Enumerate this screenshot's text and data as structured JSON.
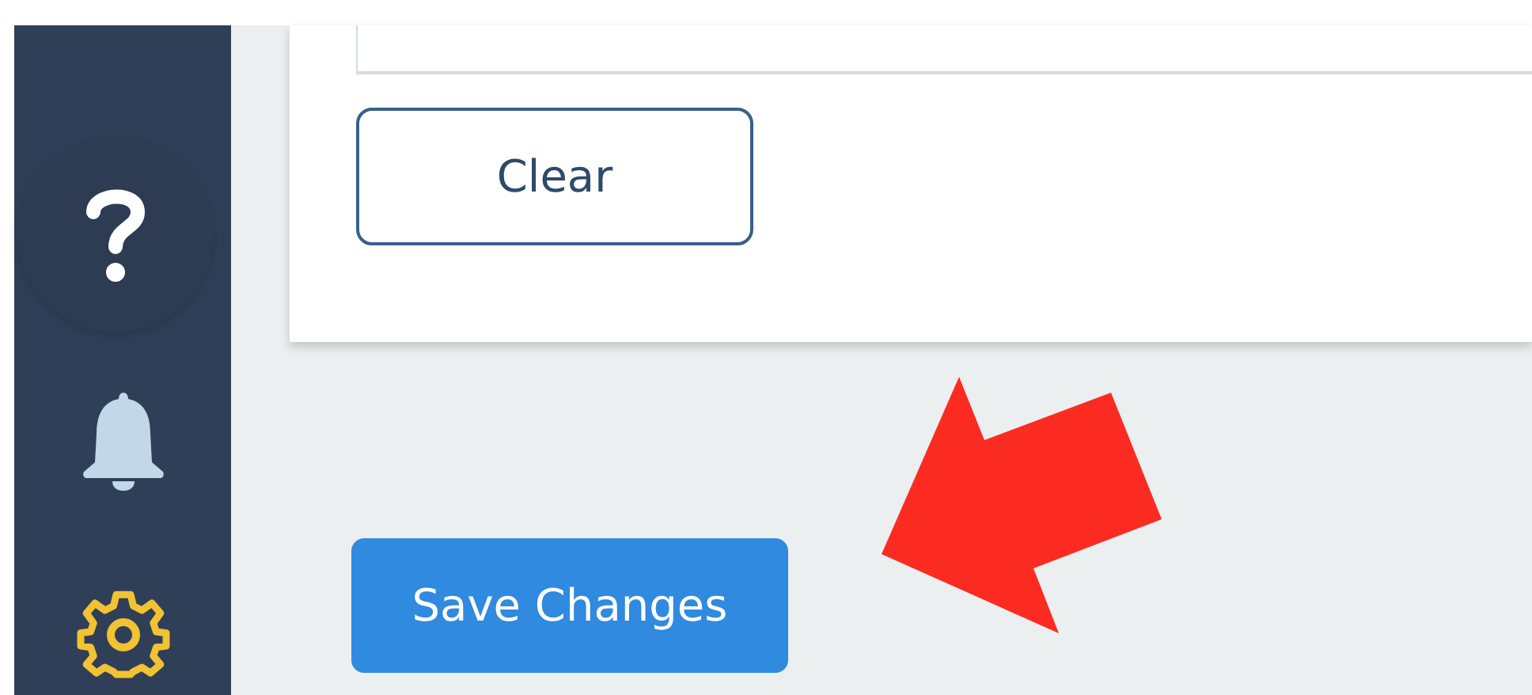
{
  "card": {
    "buttons": [
      {
        "label": "Clear",
        "kind": "outline"
      }
    ]
  },
  "actions": [
    {
      "label": "Save Changes",
      "kind": "primary"
    }
  ]
}
